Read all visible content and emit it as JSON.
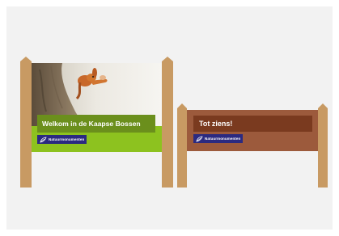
{
  "signs": [
    {
      "title": "Welkom in de Kaapse Bossen",
      "logo_text": "Natuurmonumenten",
      "photo_subject": "squirrel",
      "colors": {
        "board": "#8dc21f",
        "title_bar": "#6b8f1c",
        "post": "#c89a63",
        "logo_bg": "#2b2a80"
      }
    },
    {
      "title": "Tot ziens!",
      "logo_text": "Natuurmonumenten",
      "colors": {
        "board": "#9c5a3c",
        "title_bar": "#7a3a1f",
        "post": "#c89a63",
        "logo_bg": "#2b2a80"
      }
    }
  ]
}
